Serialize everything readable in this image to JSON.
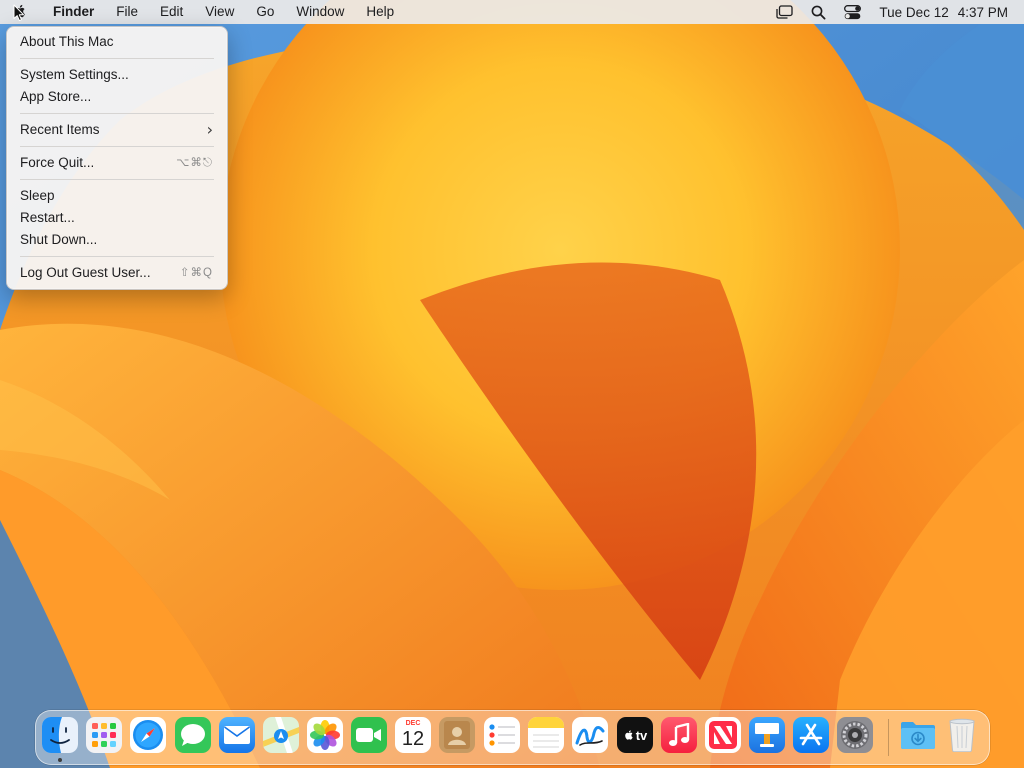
{
  "menubar": {
    "apple_icon": "apple-logo-icon",
    "app_name": "Finder",
    "menus": [
      "File",
      "Edit",
      "View",
      "Go",
      "Window",
      "Help"
    ],
    "status_icons": [
      "stage-manager-icon",
      "spotlight-search-icon",
      "control-center-icon"
    ],
    "clock": {
      "date": "Tue Dec 12",
      "time": "4:37 PM"
    }
  },
  "apple_menu": {
    "items": [
      {
        "label": "About This Mac"
      },
      {
        "label": "System Settings..."
      },
      {
        "label": "App Store..."
      },
      {
        "label": "Recent Items",
        "submenu": true
      },
      {
        "label": "Force Quit...",
        "shortcut": "⌥⌘⎋"
      },
      {
        "label": "Sleep"
      },
      {
        "label": "Restart..."
      },
      {
        "label": "Shut Down..."
      },
      {
        "label": "Log Out Guest User...",
        "shortcut": "⇧⌘Q"
      }
    ]
  },
  "dock": {
    "apps": [
      "Finder",
      "Launchpad",
      "Safari",
      "Messages",
      "Mail",
      "Maps",
      "Photos",
      "FaceTime",
      "Calendar",
      "Contacts",
      "Reminders",
      "Notes",
      "Freeform",
      "TV",
      "Music",
      "News",
      "Keynote",
      "App Store",
      "System Settings",
      "Downloads",
      "Trash"
    ],
    "running": [
      "Finder"
    ],
    "calendar": {
      "month": "DEC",
      "day": "12"
    },
    "tv_label": "tv"
  },
  "colors": {
    "wallpaper_orange": "#f7a51c",
    "wallpaper_blue": "#4c8fd0",
    "menu_background": "#f6f4f3"
  }
}
